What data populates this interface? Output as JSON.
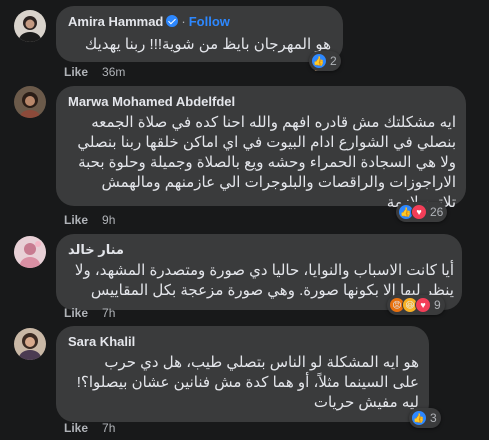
{
  "comments": [
    {
      "author": "Amira Hammad",
      "separator": "·",
      "follow_label": "Follow",
      "text": "هو المهرجان بايظ من شوية!!! ربنا يهديك 🙌🏼",
      "reaction_count": "2",
      "like_label": "Like",
      "time": "36m"
    },
    {
      "author": "Marwa Mohamed Abdelfdel",
      "text": "ايه مشكلتك مش قادره افهم والله احنا كده في صلاة الجمعه بنصلي في الشوارع ادام البيوت في اي اماكن خلقها ربنا بنصلي ولا هي السجادة الحمراء وحشه ويع بالصلاة وجميلة وحلوة بحبة الاراجوزات والراقصات والبلوجرات الي عازمنهم ومالهمش تلاتين لازمة",
      "reaction_count": "26",
      "like_label": "Like",
      "time": "9h"
    },
    {
      "author": "منار خالد",
      "text": "أيا كانت الاسباب والنوايا، حاليا دي صورة ومتصدرة المشهد، ولا ينظر ليها إلا بكونها صورة. وهي صورة مزعجة بكل المقاييس",
      "reaction_count": "9",
      "like_label": "Like",
      "time": "7h"
    },
    {
      "author": "Sara Khalil",
      "text": "هو ايه المشكلة لو الناس بتصلي طيب، هل دي حرب على السينما مثلاً، أو هما كدة مش فنانين عشان بيصلوا؟! ليه مفيش حريات",
      "reaction_count": "3",
      "like_label": "Like",
      "time": "7h"
    }
  ],
  "colors": {
    "background": "#18191a",
    "bubble": "#3a3b3c",
    "text": "#e4e6eb",
    "secondary": "#b0b3b8",
    "accent": "#2d88ff"
  },
  "icons": [
    "verified-badge-icon",
    "like-reaction-icon",
    "love-reaction-icon",
    "haha-reaction-icon",
    "angry-reaction-icon"
  ]
}
